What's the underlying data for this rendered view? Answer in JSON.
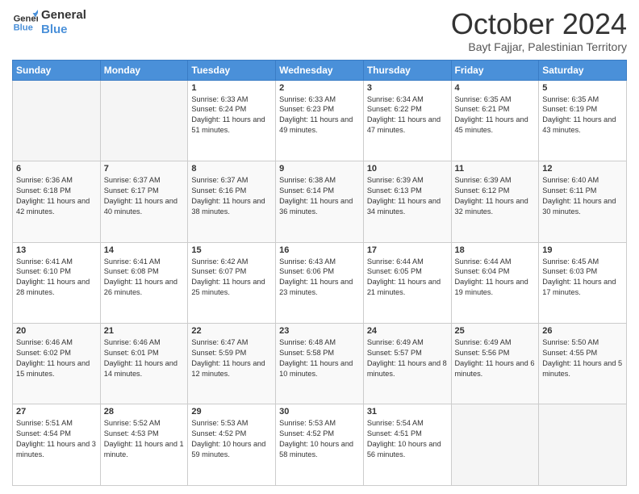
{
  "logo": {
    "line1": "General",
    "line2": "Blue"
  },
  "header": {
    "month": "October 2024",
    "location": "Bayt Fajjar, Palestinian Territory"
  },
  "weekdays": [
    "Sunday",
    "Monday",
    "Tuesday",
    "Wednesday",
    "Thursday",
    "Friday",
    "Saturday"
  ],
  "weeks": [
    [
      {
        "day": "",
        "info": ""
      },
      {
        "day": "",
        "info": ""
      },
      {
        "day": "1",
        "info": "Sunrise: 6:33 AM\nSunset: 6:24 PM\nDaylight: 11 hours and 51 minutes."
      },
      {
        "day": "2",
        "info": "Sunrise: 6:33 AM\nSunset: 6:23 PM\nDaylight: 11 hours and 49 minutes."
      },
      {
        "day": "3",
        "info": "Sunrise: 6:34 AM\nSunset: 6:22 PM\nDaylight: 11 hours and 47 minutes."
      },
      {
        "day": "4",
        "info": "Sunrise: 6:35 AM\nSunset: 6:21 PM\nDaylight: 11 hours and 45 minutes."
      },
      {
        "day": "5",
        "info": "Sunrise: 6:35 AM\nSunset: 6:19 PM\nDaylight: 11 hours and 43 minutes."
      }
    ],
    [
      {
        "day": "6",
        "info": "Sunrise: 6:36 AM\nSunset: 6:18 PM\nDaylight: 11 hours and 42 minutes."
      },
      {
        "day": "7",
        "info": "Sunrise: 6:37 AM\nSunset: 6:17 PM\nDaylight: 11 hours and 40 minutes."
      },
      {
        "day": "8",
        "info": "Sunrise: 6:37 AM\nSunset: 6:16 PM\nDaylight: 11 hours and 38 minutes."
      },
      {
        "day": "9",
        "info": "Sunrise: 6:38 AM\nSunset: 6:14 PM\nDaylight: 11 hours and 36 minutes."
      },
      {
        "day": "10",
        "info": "Sunrise: 6:39 AM\nSunset: 6:13 PM\nDaylight: 11 hours and 34 minutes."
      },
      {
        "day": "11",
        "info": "Sunrise: 6:39 AM\nSunset: 6:12 PM\nDaylight: 11 hours and 32 minutes."
      },
      {
        "day": "12",
        "info": "Sunrise: 6:40 AM\nSunset: 6:11 PM\nDaylight: 11 hours and 30 minutes."
      }
    ],
    [
      {
        "day": "13",
        "info": "Sunrise: 6:41 AM\nSunset: 6:10 PM\nDaylight: 11 hours and 28 minutes."
      },
      {
        "day": "14",
        "info": "Sunrise: 6:41 AM\nSunset: 6:08 PM\nDaylight: 11 hours and 26 minutes."
      },
      {
        "day": "15",
        "info": "Sunrise: 6:42 AM\nSunset: 6:07 PM\nDaylight: 11 hours and 25 minutes."
      },
      {
        "day": "16",
        "info": "Sunrise: 6:43 AM\nSunset: 6:06 PM\nDaylight: 11 hours and 23 minutes."
      },
      {
        "day": "17",
        "info": "Sunrise: 6:44 AM\nSunset: 6:05 PM\nDaylight: 11 hours and 21 minutes."
      },
      {
        "day": "18",
        "info": "Sunrise: 6:44 AM\nSunset: 6:04 PM\nDaylight: 11 hours and 19 minutes."
      },
      {
        "day": "19",
        "info": "Sunrise: 6:45 AM\nSunset: 6:03 PM\nDaylight: 11 hours and 17 minutes."
      }
    ],
    [
      {
        "day": "20",
        "info": "Sunrise: 6:46 AM\nSunset: 6:02 PM\nDaylight: 11 hours and 15 minutes."
      },
      {
        "day": "21",
        "info": "Sunrise: 6:46 AM\nSunset: 6:01 PM\nDaylight: 11 hours and 14 minutes."
      },
      {
        "day": "22",
        "info": "Sunrise: 6:47 AM\nSunset: 5:59 PM\nDaylight: 11 hours and 12 minutes."
      },
      {
        "day": "23",
        "info": "Sunrise: 6:48 AM\nSunset: 5:58 PM\nDaylight: 11 hours and 10 minutes."
      },
      {
        "day": "24",
        "info": "Sunrise: 6:49 AM\nSunset: 5:57 PM\nDaylight: 11 hours and 8 minutes."
      },
      {
        "day": "25",
        "info": "Sunrise: 6:49 AM\nSunset: 5:56 PM\nDaylight: 11 hours and 6 minutes."
      },
      {
        "day": "26",
        "info": "Sunrise: 5:50 AM\nSunset: 4:55 PM\nDaylight: 11 hours and 5 minutes."
      }
    ],
    [
      {
        "day": "27",
        "info": "Sunrise: 5:51 AM\nSunset: 4:54 PM\nDaylight: 11 hours and 3 minutes."
      },
      {
        "day": "28",
        "info": "Sunrise: 5:52 AM\nSunset: 4:53 PM\nDaylight: 11 hours and 1 minute."
      },
      {
        "day": "29",
        "info": "Sunrise: 5:53 AM\nSunset: 4:52 PM\nDaylight: 10 hours and 59 minutes."
      },
      {
        "day": "30",
        "info": "Sunrise: 5:53 AM\nSunset: 4:52 PM\nDaylight: 10 hours and 58 minutes."
      },
      {
        "day": "31",
        "info": "Sunrise: 5:54 AM\nSunset: 4:51 PM\nDaylight: 10 hours and 56 minutes."
      },
      {
        "day": "",
        "info": ""
      },
      {
        "day": "",
        "info": ""
      }
    ]
  ]
}
